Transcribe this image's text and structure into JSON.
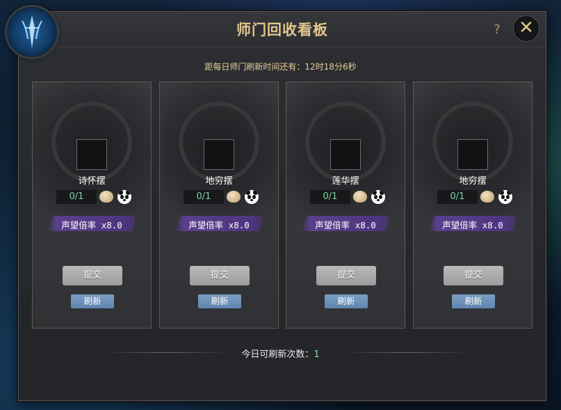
{
  "window": {
    "title": "师门回收看板",
    "help_glyph": "?",
    "close_glyph": "✕"
  },
  "timer_text": "距每日师门刷新时间还有：12时18分6秒",
  "cards": [
    {
      "name": "诗怀摆",
      "count": "0/1",
      "bonus": "声望倍率 x8.0",
      "submit": "提交",
      "refresh": "刷新"
    },
    {
      "name": "地穷摆",
      "count": "0/1",
      "bonus": "声望倍率 x8.0",
      "submit": "提交",
      "refresh": "刷新"
    },
    {
      "name": "莲华摆",
      "count": "0/1",
      "bonus": "声望倍率 x8.0",
      "submit": "提交",
      "refresh": "刷新"
    },
    {
      "name": "地穷摆",
      "count": "0/1",
      "bonus": "声望倍率 x8.0",
      "submit": "提交",
      "refresh": "刷新"
    }
  ],
  "footer": {
    "label": "今日可刷新次数：",
    "value": "1"
  },
  "icons": {
    "emblem": "sect-emblem-icon",
    "reward_1": "egg-icon",
    "reward_2": "panda-icon"
  },
  "colors": {
    "title": "#e3c78c",
    "count": "#7fd6a6",
    "banner": "#5b3f8e",
    "refresh_button": "#6f93bb"
  }
}
